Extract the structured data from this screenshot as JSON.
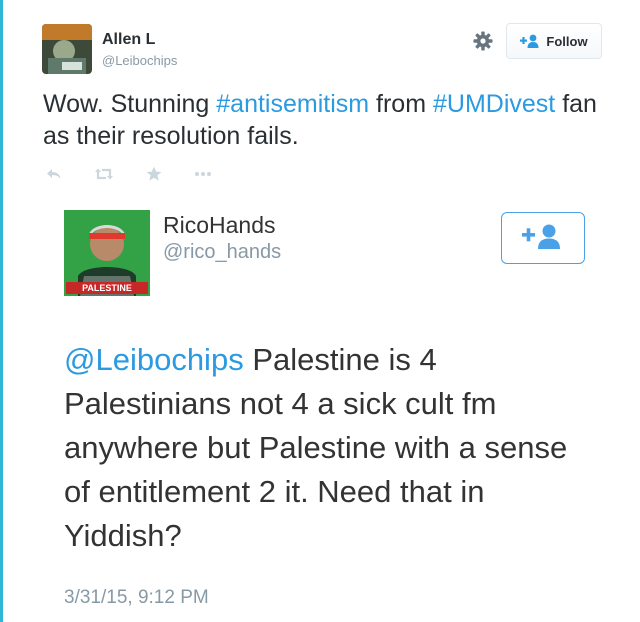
{
  "tweet": {
    "author_name": "Allen L",
    "author_handle": "@Leibochips",
    "follow_label": "Follow",
    "text_parts": [
      {
        "text": "Wow. Stunning ",
        "tag": false
      },
      {
        "text": "#antisemitism",
        "tag": true
      },
      {
        "text": " from ",
        "tag": false
      },
      {
        "text": "#UMDivest",
        "tag": true
      },
      {
        "text": " fan as their resolution fails.",
        "tag": false
      }
    ],
    "actions": [
      "reply-icon",
      "retweet-icon",
      "favorite-icon",
      "more-icon"
    ]
  },
  "embedded": {
    "author_name": "RicoHands",
    "author_handle": "@rico_hands",
    "avatar_caption": "PALESTINE",
    "mention": "@Leibochips",
    "body": " Palestine is 4 Palestinians not 4 a sick cult fm anywhere but Palestine with a sense of entitlement 2 it. Need that in Yiddish?",
    "timestamp": "3/31/15, 9:12 PM"
  },
  "colors": {
    "accent": "#2b9ae0",
    "muted": "#8899a6",
    "text": "#292f33",
    "left_bar": "#2fb6d6"
  }
}
